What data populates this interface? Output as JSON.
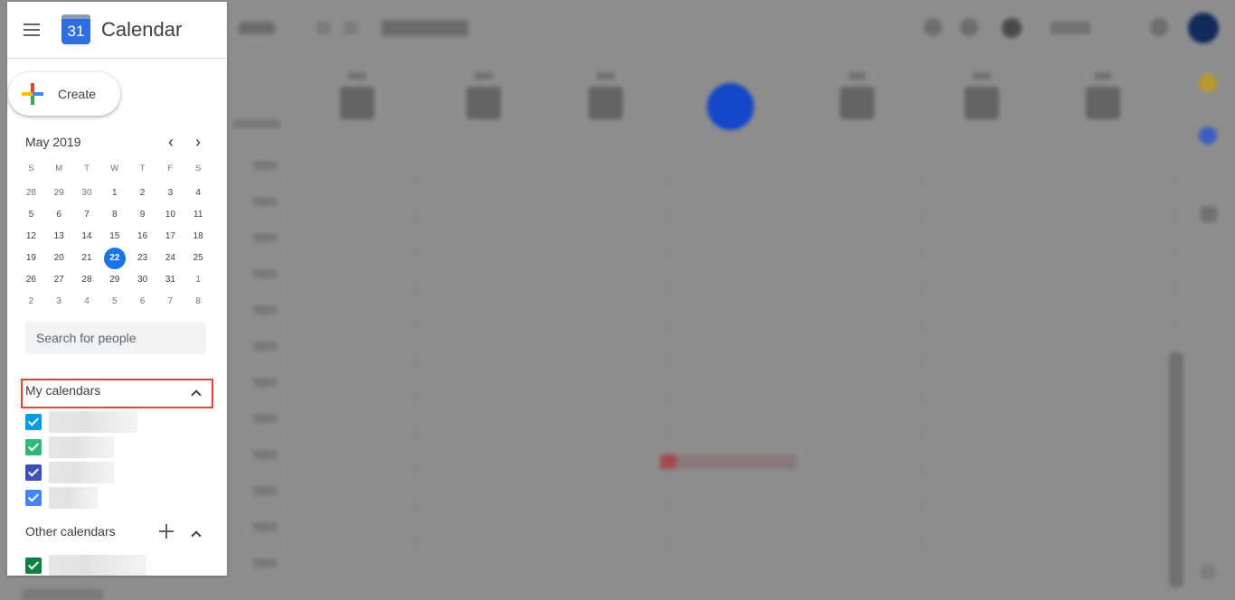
{
  "app": {
    "title": "Calendar",
    "logo_day": "31",
    "menu_icon": "hamburger-menu-icon"
  },
  "create": {
    "label": "Create",
    "icon": "plus-multicolor-icon"
  },
  "mini_calendar": {
    "month_label": "May 2019",
    "prev_icon": "chevron-left-icon",
    "next_icon": "chevron-right-icon",
    "weekday_headers": [
      "S",
      "M",
      "T",
      "W",
      "T",
      "F",
      "S"
    ],
    "weeks": [
      [
        {
          "d": "28",
          "other": true
        },
        {
          "d": "29",
          "other": true
        },
        {
          "d": "30",
          "other": true
        },
        {
          "d": "1"
        },
        {
          "d": "2"
        },
        {
          "d": "3"
        },
        {
          "d": "4"
        }
      ],
      [
        {
          "d": "5"
        },
        {
          "d": "6"
        },
        {
          "d": "7"
        },
        {
          "d": "8"
        },
        {
          "d": "9"
        },
        {
          "d": "10"
        },
        {
          "d": "11"
        }
      ],
      [
        {
          "d": "12"
        },
        {
          "d": "13"
        },
        {
          "d": "14"
        },
        {
          "d": "15"
        },
        {
          "d": "16"
        },
        {
          "d": "17"
        },
        {
          "d": "18"
        }
      ],
      [
        {
          "d": "19"
        },
        {
          "d": "20"
        },
        {
          "d": "21"
        },
        {
          "d": "22",
          "today": true
        },
        {
          "d": "23"
        },
        {
          "d": "24"
        },
        {
          "d": "25"
        }
      ],
      [
        {
          "d": "26"
        },
        {
          "d": "27"
        },
        {
          "d": "28"
        },
        {
          "d": "29"
        },
        {
          "d": "30"
        },
        {
          "d": "31"
        },
        {
          "d": "1",
          "other": true
        }
      ],
      [
        {
          "d": "2",
          "other": true
        },
        {
          "d": "3",
          "other": true
        },
        {
          "d": "4",
          "other": true
        },
        {
          "d": "5",
          "other": true
        },
        {
          "d": "6",
          "other": true
        },
        {
          "d": "7",
          "other": true
        },
        {
          "d": "8",
          "other": true
        }
      ]
    ],
    "today_color": "#1a73e8"
  },
  "search_people": {
    "placeholder": "Search for people",
    "value": ""
  },
  "my_calendars": {
    "title": "My calendars",
    "collapse_icon": "chevron-up-icon",
    "highlight_color": "#e2433a",
    "items": [
      {
        "name": "",
        "color": "#039be5",
        "checked": true
      },
      {
        "name": "",
        "color": "#33b679",
        "checked": true
      },
      {
        "name": "",
        "color": "#3f51b5",
        "checked": true
      },
      {
        "name": "",
        "color": "#4285f4",
        "checked": true
      }
    ]
  },
  "other_calendars": {
    "title": "Other calendars",
    "add_icon": "plus-icon",
    "collapse_icon": "chevron-up-icon",
    "items": [
      {
        "name": "",
        "color": "#0b8043",
        "checked": true
      }
    ]
  }
}
